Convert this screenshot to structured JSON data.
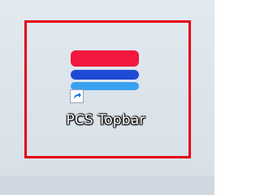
{
  "desktop_shortcut": {
    "label": "PCS Topbar",
    "icon_name": "pcs-topbar-app-icon",
    "overlay_icon_name": "shortcut-arrow-icon",
    "icon_colors": {
      "red": "#f2183f",
      "blue": "#1f4ad6",
      "light_blue": "#39a2ef"
    }
  },
  "highlight": {
    "color": "#e60012"
  }
}
